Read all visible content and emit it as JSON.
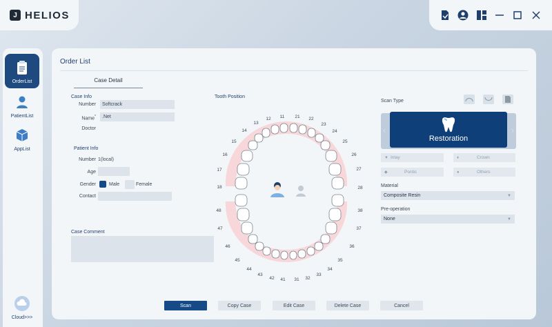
{
  "app": {
    "name": "HELIOS"
  },
  "sidebar": {
    "items": [
      {
        "label": "OrderList"
      },
      {
        "label": "PatientList"
      },
      {
        "label": "AppList"
      }
    ],
    "cloud_label": "Cloud>>>"
  },
  "main": {
    "title": "Order List",
    "tab": "Case Detail",
    "case_info": {
      "header": "Case Info",
      "number_label": "Number",
      "number_value": "Softcrack",
      "name_label": "Name",
      "name_required": "*",
      "name_value": ".Net",
      "doctor_label": "Doctor"
    },
    "patient_info": {
      "header": "Patient Info",
      "number_label": "Number",
      "number_value": "1(local)",
      "age_label": "Age",
      "gender_label": "Gender",
      "gender_male": "Male",
      "gender_female": "Female",
      "contact_label": "Contact"
    },
    "case_comment": {
      "header": "Case Comment"
    },
    "tooth_position": {
      "header": "Tooth Position",
      "upper": [
        "11",
        "12",
        "13",
        "14",
        "15",
        "16",
        "17",
        "18",
        "21",
        "22",
        "23",
        "24",
        "25",
        "26",
        "27",
        "28"
      ],
      "lower": [
        "48",
        "47",
        "46",
        "45",
        "44",
        "43",
        "42",
        "41",
        "31",
        "32",
        "33",
        "34",
        "35",
        "36",
        "37",
        "38"
      ]
    },
    "scan_type": {
      "header": "Scan Type",
      "selected": "Restoration",
      "options": [
        "Inlay",
        "Crown",
        "Pontic",
        "Others"
      ]
    },
    "material": {
      "label": "Material",
      "value": "Composite Resin"
    },
    "preoperation": {
      "label": "Pre-operation",
      "value": "None"
    },
    "buttons": {
      "scan": "Scan",
      "copy": "Copy Case",
      "edit": "Edit Case",
      "delete": "Delete Case",
      "cancel": "Cancel"
    }
  },
  "colors": {
    "accent": "#164a86",
    "panel": "#f3f6f9",
    "gum": "#f7d7d9"
  }
}
